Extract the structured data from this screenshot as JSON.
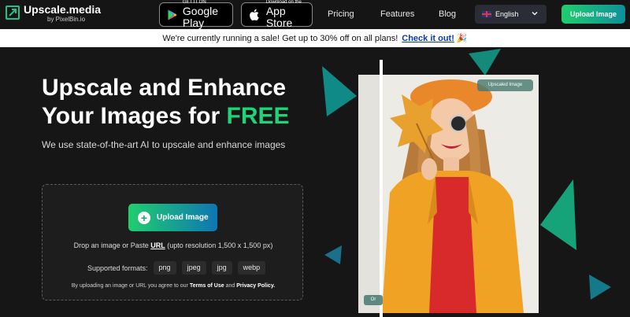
{
  "nav": {
    "logo_title": "Upscale.media",
    "logo_sub": "by PixelBin.io",
    "google_play_small": "GET IT ON",
    "google_play_big": "Google Play",
    "app_store_small": "Download on the",
    "app_store_big": "App Store",
    "links": [
      "Pricing",
      "Features",
      "Blog"
    ],
    "language": "English",
    "upload_label": "Upload Image"
  },
  "banner": {
    "text": "We're currently running a sale! Get up to 30% off on all plans!",
    "link": "Check it out!",
    "emoji": "🎉"
  },
  "hero": {
    "title_line1": "Upscale and Enhance",
    "title_line2_prefix": "Your Images for ",
    "title_highlight": "FREE",
    "subtitle": "We use state-of-the-art AI to upscale and enhance images"
  },
  "dropbox": {
    "button_label": "Upload Image",
    "drop_prefix": "Drop an image or Paste ",
    "drop_url": "URL",
    "drop_suffix": " (upto resolution 1,500 x 1,500 px)",
    "formats_label": "Supported formats:",
    "formats": [
      "png",
      "jpeg",
      "jpg",
      "webp"
    ],
    "terms_prefix": "By uploading an image or URL you agree to our ",
    "terms_link": "Terms of Use",
    "terms_and": " and ",
    "privacy_link": "Privacy Policy."
  },
  "preview": {
    "upscaled_badge": "Upscaled Image",
    "original_badge": "Or"
  },
  "colors": {
    "accent_green": "#1ed37a",
    "banner_link": "#0d3aa8",
    "background": "#161616"
  }
}
